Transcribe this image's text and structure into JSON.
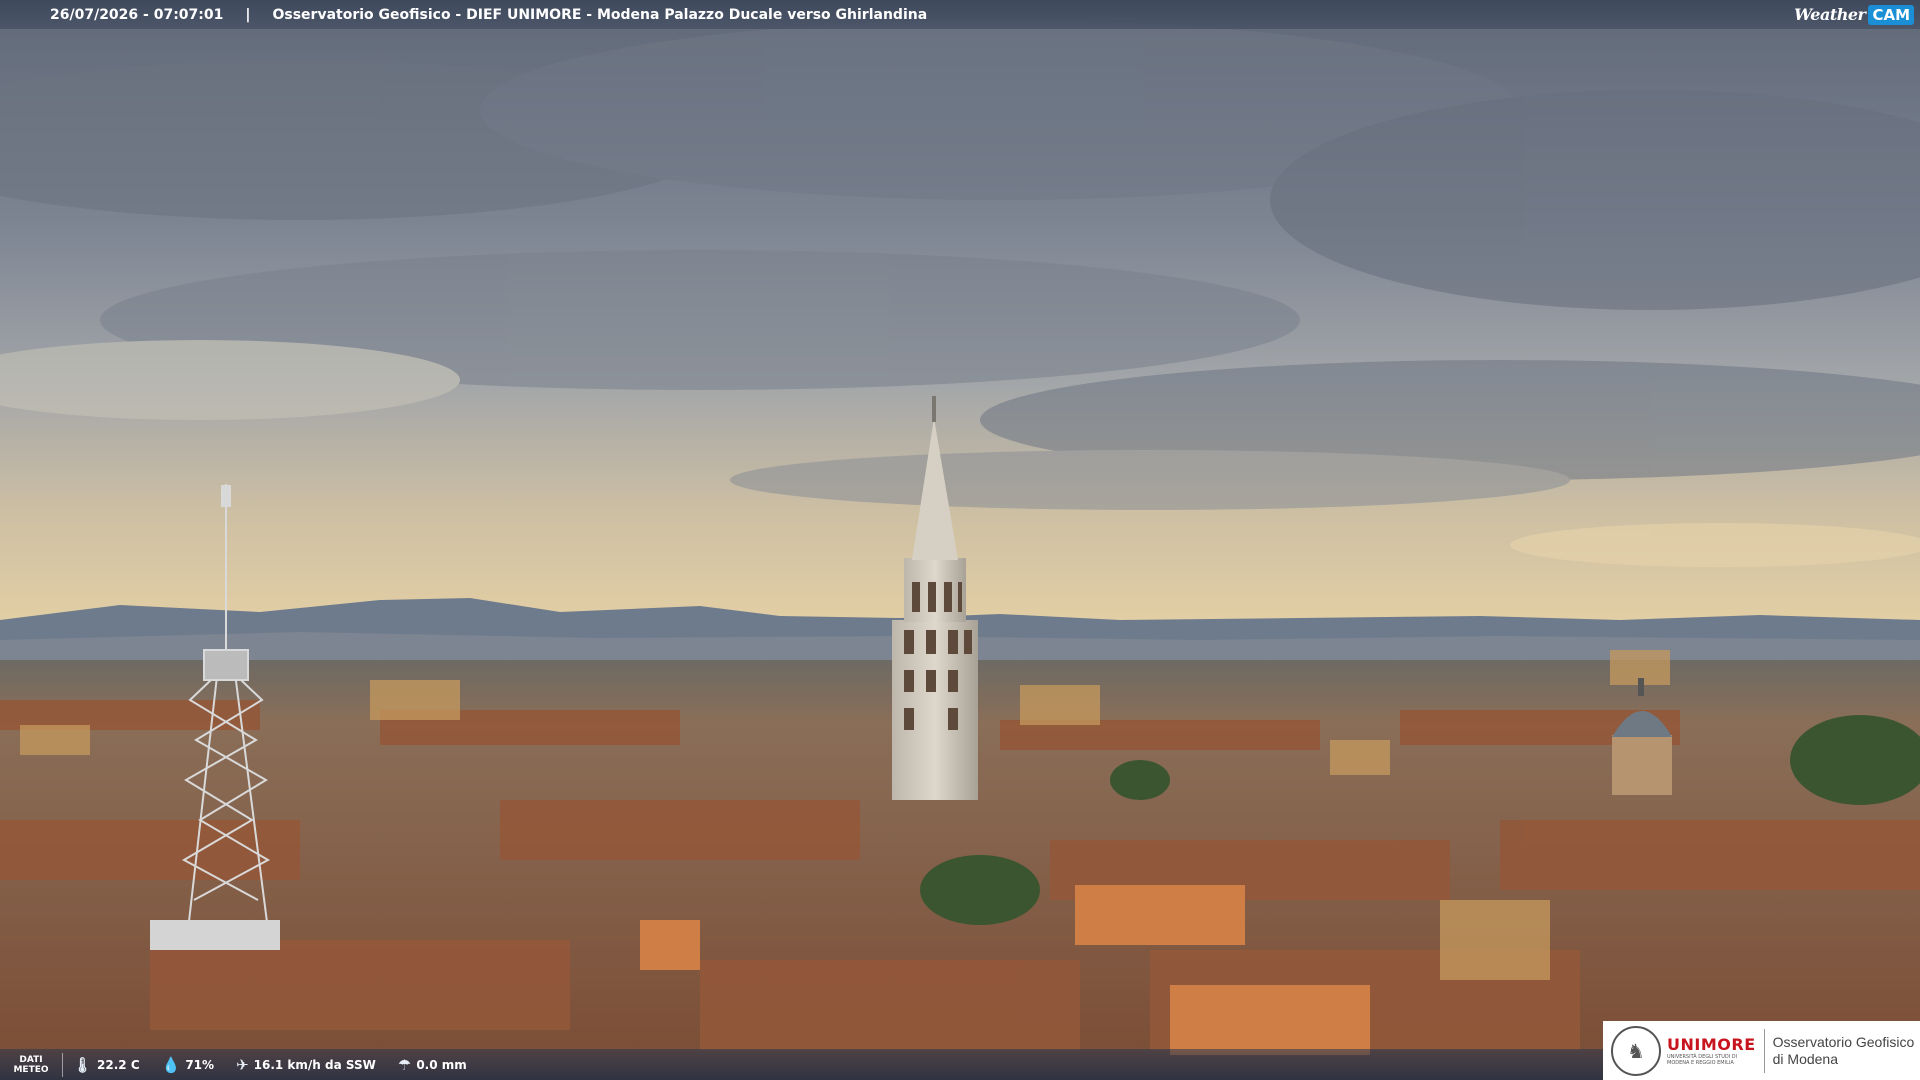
{
  "header": {
    "timestamp": "26/07/2026 - 07:07:01",
    "separator": "|",
    "title": "Osservatorio Geofisico - DIEF UNIMORE - Modena Palazzo Ducale verso Ghirlandina",
    "brand_weather": "Weather",
    "brand_cam": "CAM"
  },
  "weather_bar": {
    "label_line1": "DATI",
    "label_line2": "METEO",
    "temperature": "22.2 C",
    "humidity": "71%",
    "wind": "16.1 km/h da SSW",
    "rain": "0.0 mm",
    "icons": [
      "thermometer-icon",
      "droplet-icon",
      "wind-icon",
      "rain-icon"
    ]
  },
  "logo": {
    "uni": "UNI",
    "more": "MORE",
    "uni_sub1": "UNIVERSITÀ DEGLI STUDI DI",
    "uni_sub2": "MODENA E REGGIO EMILIA",
    "obs_line1": "Osservatorio Geofisico",
    "obs_line2": "di Modena"
  },
  "colors": {
    "sky_top": "#5f6877",
    "sky_bottom": "#e8d4aa",
    "roofs": "#8c5a3f",
    "brand_blue": "#1b8fd6",
    "unimore_red": "#c8141e"
  }
}
